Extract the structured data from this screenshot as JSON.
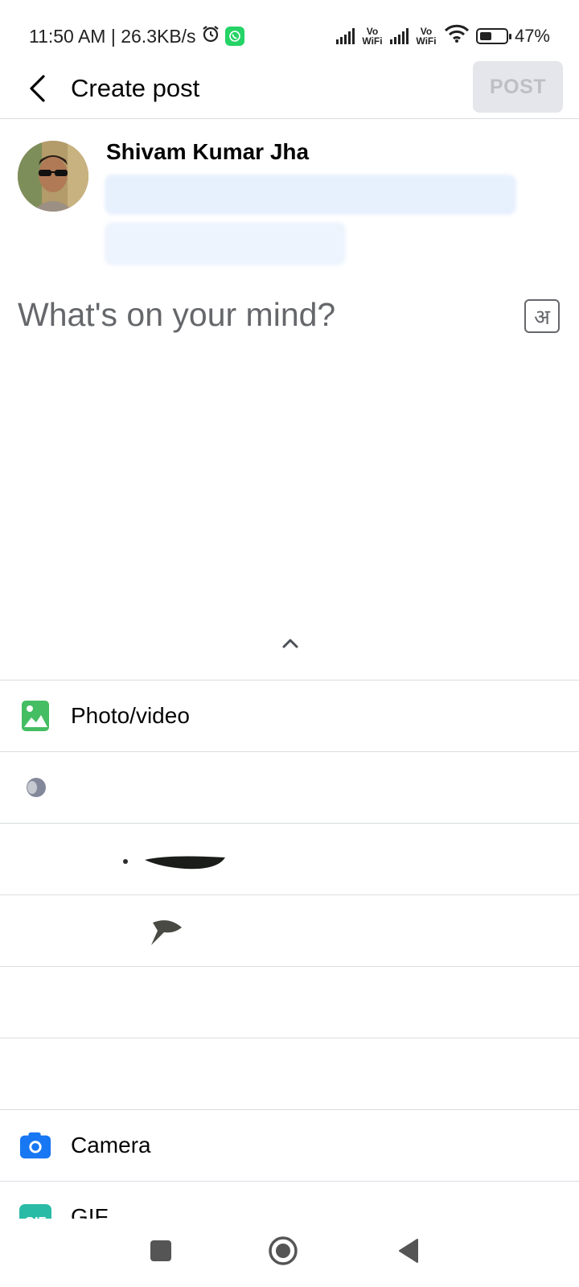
{
  "status_bar": {
    "time_speed": "11:50 AM | 26.3KB/s",
    "vowifi_1": "Vo WiFi",
    "vowifi_2": "Vo WiFi",
    "battery_percent": "47%",
    "battery_level": 0.47
  },
  "header": {
    "title": "Create post",
    "post_button": "POST"
  },
  "profile": {
    "name": "Shivam Kumar Jha"
  },
  "composer": {
    "placeholder": "What's on your mind?",
    "language_toggle": "अ"
  },
  "options": [
    {
      "label": "Photo/video",
      "icon": "photo-video-icon",
      "color": "#45bd62"
    },
    {
      "label": "",
      "icon": "obscured-icon"
    },
    {
      "label": "",
      "icon": "obscured-icon"
    },
    {
      "label": "",
      "icon": "obscured-icon"
    },
    {
      "label": "",
      "icon": "obscured-icon"
    },
    {
      "label": "",
      "icon": "obscured-icon"
    },
    {
      "label": "Camera",
      "icon": "camera-icon",
      "color": "#1877f2"
    },
    {
      "label": "GIF",
      "icon": "gif-icon",
      "color": "#2abba7"
    }
  ],
  "nav": {
    "recents": "square-nav-icon",
    "home": "circle-nav-icon",
    "back": "triangle-nav-icon"
  }
}
